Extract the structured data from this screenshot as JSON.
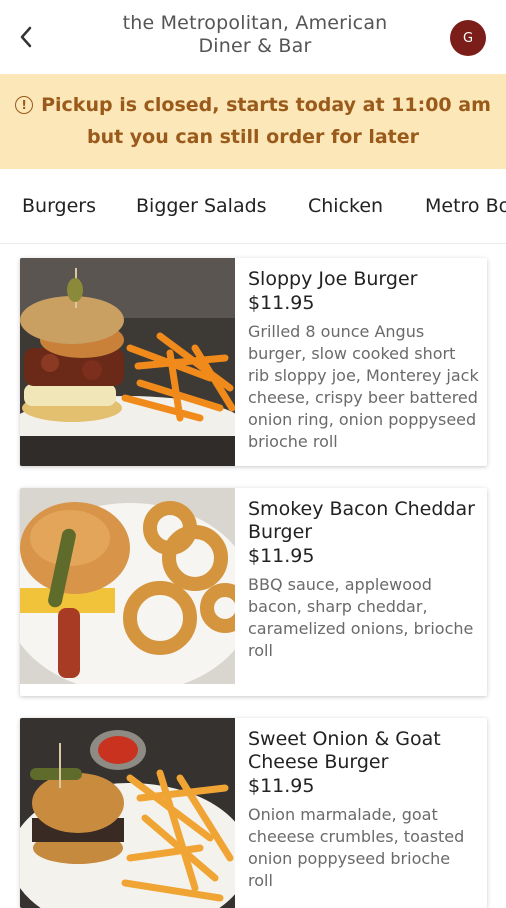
{
  "header": {
    "title_line1": "the Metropolitan, American",
    "title_line2": "Diner & Bar",
    "avatar_initial": "G"
  },
  "banner": {
    "line1": "Pickup is closed, starts today at 11:00 am",
    "line2": "but you can still order for later",
    "icon": "info-icon"
  },
  "tabs": [
    {
      "label": "Burgers"
    },
    {
      "label": "Bigger Salads"
    },
    {
      "label": "Chicken"
    },
    {
      "label": "Metro Bowls"
    }
  ],
  "items": [
    {
      "name": "Sloppy Joe Burger",
      "price": "$11.95",
      "description": "Grilled 8 ounce Angus burger, slow cooked short rib sloppy joe, Monterey jack cheese, crispy beer battered onion ring, onion poppyseed brioche roll"
    },
    {
      "name": "Smokey Bacon Cheddar Burger",
      "price": "$11.95",
      "description": "BBQ sauce, applewood bacon, sharp cheddar, caramelized onions, brioche roll"
    },
    {
      "name": "Sweet Onion & Goat Cheese Burger",
      "price": "$11.95",
      "description": "Onion marmalade, goat cheeese crumbles, toasted onion poppyseed brioche roll"
    }
  ],
  "colors": {
    "banner_bg": "#fbe7b7",
    "banner_text": "#9a5a1c",
    "avatar_bg": "#7b1d18"
  }
}
